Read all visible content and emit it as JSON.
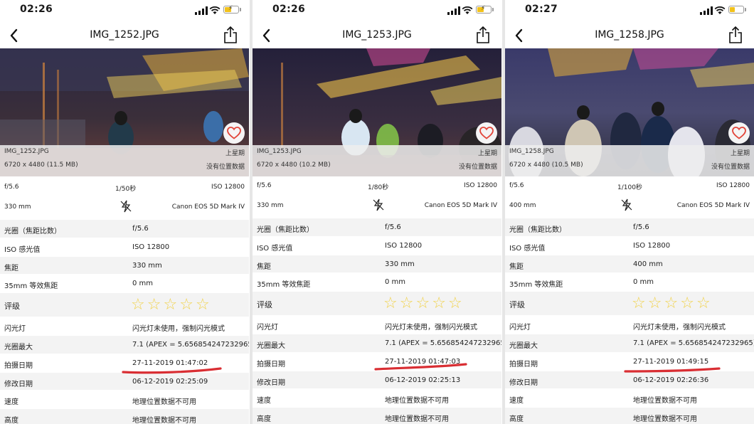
{
  "colors": {
    "accent_red": "#d92e33",
    "star_yellow": "#f1d24a",
    "heart_red": "#e2453a"
  },
  "icons": [
    "chevron-left-icon",
    "share-icon",
    "heart-icon",
    "flash-off-icon",
    "star-icon",
    "signal-icon",
    "wifi-icon",
    "battery-charging-icon"
  ],
  "panels": [
    {
      "time": "02:26",
      "title": "IMG_1252.JPG",
      "photo": {
        "filename": "IMG_1252.JPG",
        "weekday": "上星期",
        "dimensions": "6720 x 4480 (11.5 MB)",
        "location": "没有位置数据"
      },
      "summary": {
        "aperture": "f/5.6",
        "shutter": "1/50秒",
        "iso": "ISO 12800",
        "focal": "330 mm",
        "camera": "Canon EOS 5D Mark IV"
      },
      "rows": [
        {
          "label": "光圈（焦距比数）",
          "value": "f/5.6"
        },
        {
          "label": "ISO 感光值",
          "value": "ISO 12800"
        },
        {
          "label": "焦距",
          "value": "330 mm"
        },
        {
          "label": "35mm 等效焦距",
          "value": "0 mm"
        }
      ],
      "rating_label": "评级",
      "rows2": [
        {
          "label": "闪光灯",
          "value": "闪光灯未使用，强制闪光模式"
        },
        {
          "label": "光圈最大",
          "value": "7.1 (APEX = 5.656854247232965)"
        },
        {
          "label": "拍摄日期",
          "value": "27-11-2019 01:47:02"
        },
        {
          "label": "修改日期",
          "value": "06-12-2019 02:25:09"
        },
        {
          "label": "速度",
          "value": "地理位置数据不可用"
        },
        {
          "label": "高度",
          "value": "地理位置数据不可用"
        }
      ]
    },
    {
      "time": "02:26",
      "title": "IMG_1253.JPG",
      "photo": {
        "filename": "IMG_1253.JPG",
        "weekday": "上星期",
        "dimensions": "6720 x 4480 (10.2 MB)",
        "location": "没有位置数据"
      },
      "summary": {
        "aperture": "f/5.6",
        "shutter": "1/80秒",
        "iso": "ISO 12800",
        "focal": "330 mm",
        "camera": "Canon EOS 5D Mark IV"
      },
      "rows": [
        {
          "label": "光圈（焦距比数）",
          "value": "f/5.6"
        },
        {
          "label": "ISO 感光值",
          "value": "ISO 12800"
        },
        {
          "label": "焦距",
          "value": "330 mm"
        },
        {
          "label": "35mm 等效焦距",
          "value": "0 mm"
        }
      ],
      "rating_label": "评级",
      "rows2": [
        {
          "label": "闪光灯",
          "value": "闪光灯未使用，强制闪光模式"
        },
        {
          "label": "光圈最大",
          "value": "7.1 (APEX = 5.656854247232965)"
        },
        {
          "label": "拍摄日期",
          "value": "27-11-2019 01:47:03"
        },
        {
          "label": "修改日期",
          "value": "06-12-2019 02:25:13"
        },
        {
          "label": "速度",
          "value": "地理位置数据不可用"
        },
        {
          "label": "高度",
          "value": "地理位置数据不可用"
        }
      ]
    },
    {
      "time": "02:27",
      "title": "IMG_1258.JPG",
      "photo": {
        "filename": "IMG_1258.JPG",
        "weekday": "上星期",
        "dimensions": "6720 x 4480 (10.5 MB)",
        "location": "没有位置数据"
      },
      "summary": {
        "aperture": "f/5.6",
        "shutter": "1/100秒",
        "iso": "ISO 12800",
        "focal": "400 mm",
        "camera": "Canon EOS 5D Mark IV"
      },
      "rows": [
        {
          "label": "光圈（焦距比数）",
          "value": "f/5.6"
        },
        {
          "label": "ISO 感光值",
          "value": "ISO 12800"
        },
        {
          "label": "焦距",
          "value": "400 mm"
        },
        {
          "label": "35mm 等效焦距",
          "value": "0 mm"
        }
      ],
      "rating_label": "评级",
      "rows2": [
        {
          "label": "闪光灯",
          "value": "闪光灯未使用，强制闪光模式"
        },
        {
          "label": "光圈最大",
          "value": "7.1 (APEX = 5.656854247232965)"
        },
        {
          "label": "拍摄日期",
          "value": "27-11-2019 01:49:15"
        },
        {
          "label": "修改日期",
          "value": "06-12-2019 02:26:36"
        },
        {
          "label": "速度",
          "value": "地理位置数据不可用"
        },
        {
          "label": "高度",
          "value": "地理位置数据不可用"
        }
      ]
    }
  ]
}
